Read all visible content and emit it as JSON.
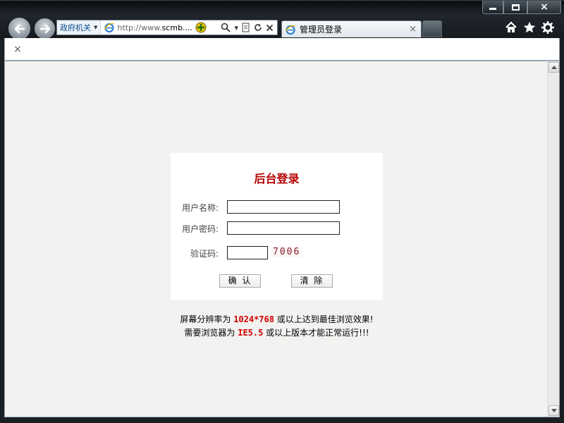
{
  "browser": {
    "zone_label": "政府机关",
    "url_prefix": "http://www.",
    "url_host": "scmb....",
    "tab_title": "管理员登录",
    "tab_close": "×",
    "bar_close": "×",
    "window_controls": {
      "minimize": "minimize-icon",
      "maximize": "maximize-icon",
      "close": "×"
    },
    "toolbar_icons": [
      "home-icon",
      "star-icon",
      "gear-icon"
    ]
  },
  "login": {
    "title": "后台登录",
    "username_label": "用户名称:",
    "password_label": "用户密码:",
    "captcha_label": "验证码:",
    "captcha_value": "7006",
    "confirm_button": "确 认",
    "clear_button": "清 除"
  },
  "notice": {
    "line1_prefix": "屏幕分辨率为 ",
    "line1_highlight": "1024*768",
    "line1_suffix": " 或以上达到最佳浏览效果!",
    "line2_prefix": "需要浏览器为 ",
    "line2_highlight": "IE5.5",
    "line2_suffix": " 或以上版本才能正常运行!!!"
  },
  "colors": {
    "title_red": "#b40000",
    "highlight_red": "#d00000",
    "page_bg": "#f2f2f0"
  }
}
